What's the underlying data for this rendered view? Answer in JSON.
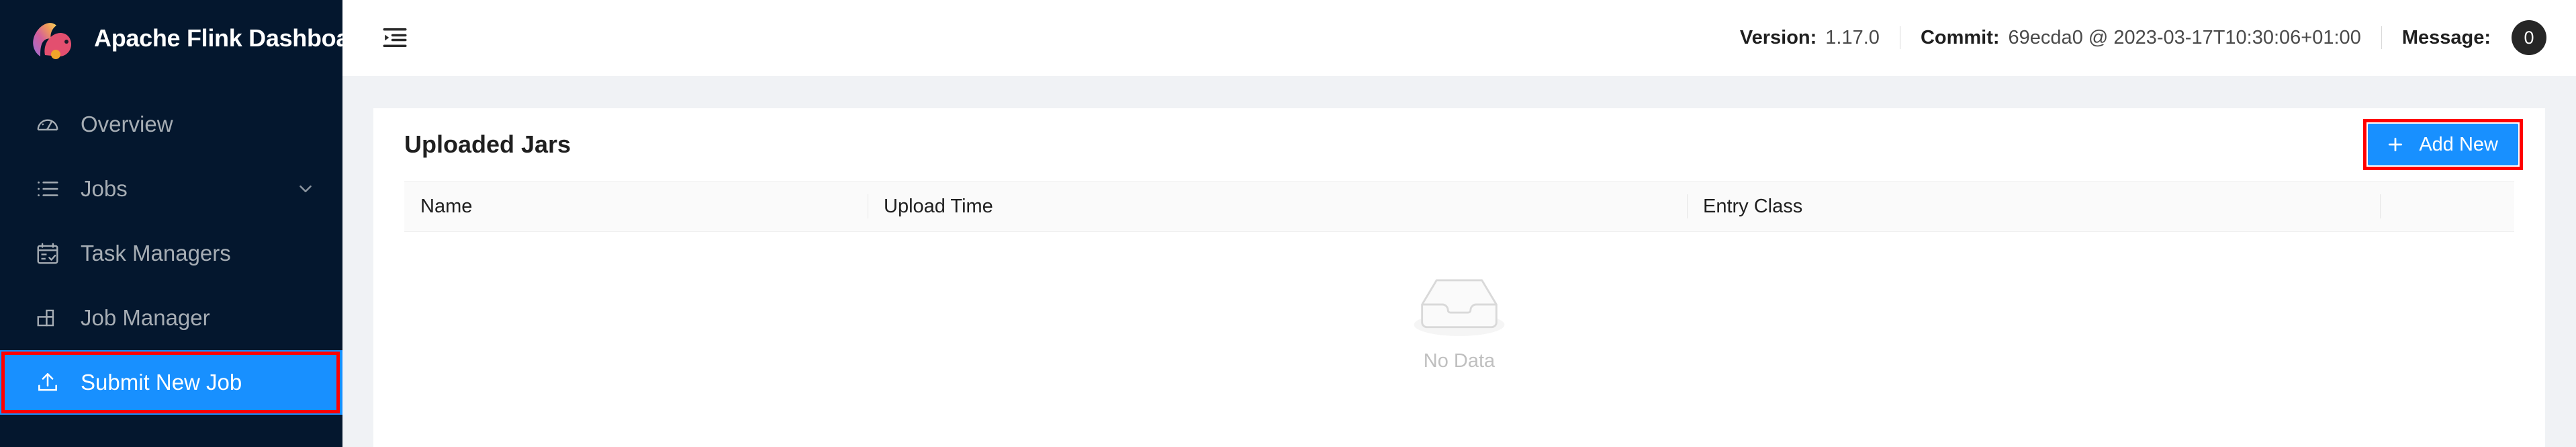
{
  "brand": {
    "title": "Apache Flink Dashboard",
    "logo_icon": "flink-squirrel-logo"
  },
  "sidebar": {
    "items": [
      {
        "label": "Overview",
        "icon": "dashboard-icon",
        "active": false,
        "has_arrow": false,
        "annotated": false
      },
      {
        "label": "Jobs",
        "icon": "list-icon",
        "active": false,
        "has_arrow": true,
        "annotated": false
      },
      {
        "label": "Task Managers",
        "icon": "task-check-icon",
        "active": false,
        "has_arrow": false,
        "annotated": false
      },
      {
        "label": "Job Manager",
        "icon": "blocks-icon",
        "active": false,
        "has_arrow": false,
        "annotated": false
      },
      {
        "label": "Submit New Job",
        "icon": "upload-icon",
        "active": true,
        "has_arrow": false,
        "annotated": true
      }
    ]
  },
  "topbar": {
    "fold_icon": "menu-fold-icon",
    "version_label": "Version:",
    "version_value": "1.17.0",
    "commit_label": "Commit:",
    "commit_value": "69ecda0 @ 2023-03-17T10:30:06+01:00",
    "message_label": "Message:",
    "message_count": "0"
  },
  "card": {
    "title": "Uploaded Jars",
    "add_button_label": "Add New",
    "add_button_icon": "plus-icon"
  },
  "table": {
    "columns": [
      "Name",
      "Upload Time",
      "Entry Class",
      ""
    ],
    "rows": [],
    "empty_text": "No Data",
    "empty_icon": "empty-inbox-icon"
  },
  "colors": {
    "sidebar_bg": "#04172e",
    "accent": "#1890ff",
    "annotation": "#ff0000",
    "content_bg": "#f0f2f5",
    "badge_bg": "#262626"
  }
}
